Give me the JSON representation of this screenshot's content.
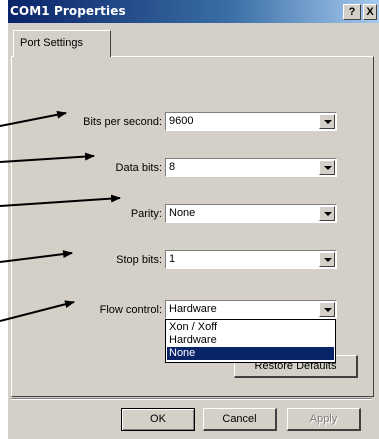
{
  "window": {
    "title": "COM1 Properties",
    "help_label": "?",
    "close_label": "X"
  },
  "tabs": [
    {
      "label": "Port Settings"
    }
  ],
  "fields": {
    "bits_per_second": {
      "label": "Bits per second:",
      "value": "9600"
    },
    "data_bits": {
      "label": "Data bits:",
      "value": "8"
    },
    "parity": {
      "label": "Parity:",
      "value": "None"
    },
    "stop_bits": {
      "label": "Stop bits:",
      "value": "1"
    },
    "flow_control": {
      "label": "Flow control:",
      "value": "Hardware",
      "options": [
        {
          "label": "Xon / Xoff"
        },
        {
          "label": "Hardware"
        },
        {
          "label": "None"
        }
      ],
      "highlighted_option": "None"
    }
  },
  "buttons": {
    "restore_defaults": "Restore Defaults",
    "ok": "OK",
    "cancel": "Cancel",
    "apply": "Apply"
  },
  "colors": {
    "title_bar": "#0a246a",
    "selection": "#0a246a",
    "face": "#d4d0c8"
  }
}
